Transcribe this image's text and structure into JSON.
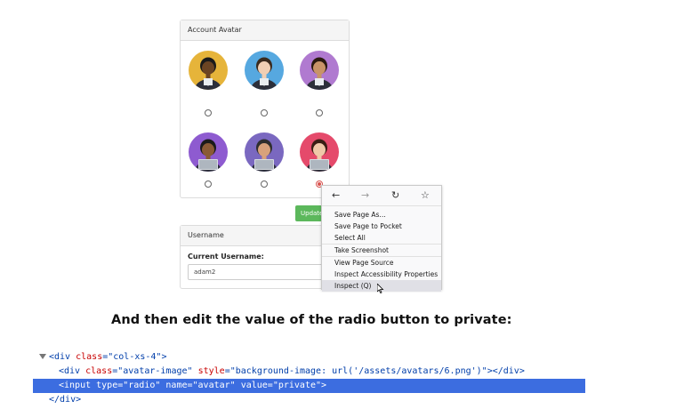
{
  "avatar_panel": {
    "title": "Account Avatar",
    "avatars": [
      {
        "name": "avatar-1",
        "bg": "#e6b43a",
        "skin": "#6b4423",
        "hair": "#1a1a1a",
        "checked": false
      },
      {
        "name": "avatar-2",
        "bg": "#56a8e0",
        "skin": "#f1cfb4",
        "hair": "#3a2a1e",
        "checked": false
      },
      {
        "name": "avatar-3",
        "bg": "#b07ad0",
        "skin": "#c89468",
        "hair": "#2a1a10",
        "checked": false
      },
      {
        "name": "avatar-4",
        "bg": "#8e5bd0",
        "skin": "#8a5a36",
        "hair": "#1a1a1a",
        "checked": false
      },
      {
        "name": "avatar-5",
        "bg": "#7a68c0",
        "skin": "#d8a27c",
        "hair": "#2e2e2e",
        "checked": false
      },
      {
        "name": "avatar-6",
        "bg": "#e54a6b",
        "skin": "#f0c8a8",
        "hair": "#3a1e14",
        "checked": true
      }
    ],
    "update_label": "Update"
  },
  "username_panel": {
    "title": "Username",
    "current_label": "Current Username:",
    "current_value": "adam2"
  },
  "context_menu": {
    "nav": {
      "back": "←",
      "forward": "→",
      "reload": "↻",
      "bookmark": "☆"
    },
    "items": [
      "Save Page As…",
      "Save Page to Pocket",
      "Select All",
      "Take Screenshot",
      "View Page Source",
      "Inspect Accessibility Properties",
      "Inspect (Q)"
    ]
  },
  "caption": "And then edit the value of the radio button to private:",
  "code": {
    "line1": {
      "tag_open": "<div ",
      "attr": "class",
      "eq": "=",
      "value": "\"col-xs-4\"",
      "close": ">"
    },
    "line2": {
      "tag_open": "<div ",
      "attr1": "class",
      "eq1": "=",
      "value1": "\"avatar-image\"",
      "sp": " ",
      "attr2": "style",
      "eq2": "=",
      "value2": "\"background-image: url('/assets/avatars/6.png')\"",
      "close": "></div>"
    },
    "line3": {
      "text": "<input type=\"radio\" name=\"avatar\" value=\"private\">"
    },
    "line4": {
      "text": "</div>"
    }
  },
  "colors": {
    "selection": "#3c6de0",
    "update_button": "#5cb85c",
    "checked_radio": "#d9534f"
  }
}
